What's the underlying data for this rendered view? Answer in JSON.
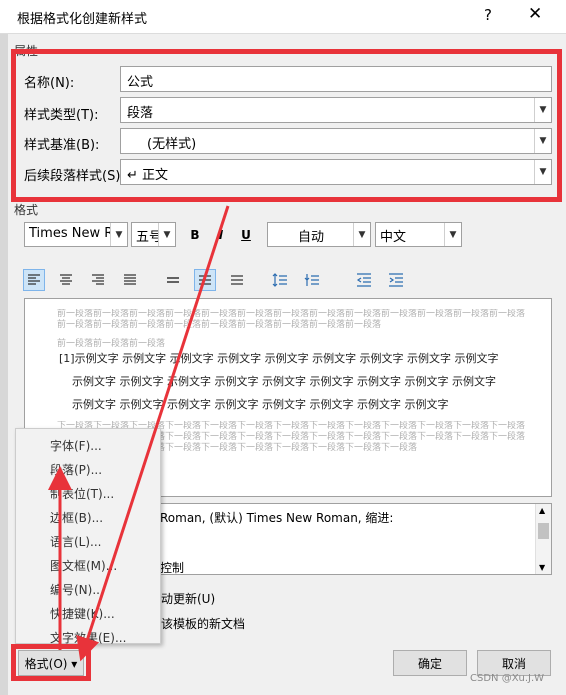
{
  "dialog": {
    "title": "根据格式化创建新样式",
    "help": "?",
    "close": "✕"
  },
  "properties": {
    "group_label": "属性",
    "name_label": "名称(N):",
    "name_value": "公式",
    "type_label": "样式类型(T):",
    "type_value": "段落",
    "base_label": "样式基准(B):",
    "base_value": "(无样式)",
    "next_label": "后续段落样式(S):",
    "next_value": "↵ 正文"
  },
  "format": {
    "group_label": "格式",
    "font": "Times New Ro",
    "size": "五号",
    "bold": "B",
    "italic": "I",
    "underline": "U",
    "color": "自动",
    "lang": "中文"
  },
  "preview": {
    "prev_para": "前一段落前一段落前一段落前一段落前一段落前一段落前一段落前一段落前一段落前一段落前一段落前一段落前一段落前一段落前一段落前一段落前一段落前一段落前一段落前一段落前一段落前一段落",
    "prev_para_end": "前一段落前一段落前一段落",
    "sample_line1": "[1]示例文字 示例文字 示例文字 示例文字 示例文字 示例文字 示例文字 示例文字 示例文字",
    "sample_line2": "示例文字 示例文字 示例文字 示例文字 示例文字 示例文字 示例文字 示例文字 示例文字",
    "sample_line3": "示例文字 示例文字 示例文字 示例文字 示例文字 示例文字 示例文字 示例文字",
    "next_para": "下一段落下一段落下一段落下一段落下一段落下一段落下一段落下一段落下一段落下一段落下一段落下一段落下一段落下一段落下一段落下一段落下一段落下一段落下一段落下一段落下一段落下一段落下一段落下一段落下一段落下一段落下一段落下一段落下一段落下一段落下一段落下一段落下一段落下一段落下一段落下一段落"
  },
  "description": {
    "line1": "Roman, (默认) Times New Roman, 缩进:",
    "line2": "控制"
  },
  "options": {
    "auto_update": "动更新(U)",
    "new_docs": "该模板的新文档"
  },
  "menu": {
    "items": [
      "字体(F)...",
      "段落(P)...",
      "制表位(T)...",
      "边框(B)...",
      "语言(L)...",
      "图文框(M)...",
      "编号(N)...",
      "快捷键(K)...",
      "文字效果(E)..."
    ]
  },
  "buttons": {
    "format": "格式(O) ▾",
    "ok": "确定",
    "cancel": "取消"
  },
  "watermark": "CSDN @Xu.J.W",
  "colors": {
    "highlight": "#e8333a",
    "selected": "#cde4f7"
  }
}
